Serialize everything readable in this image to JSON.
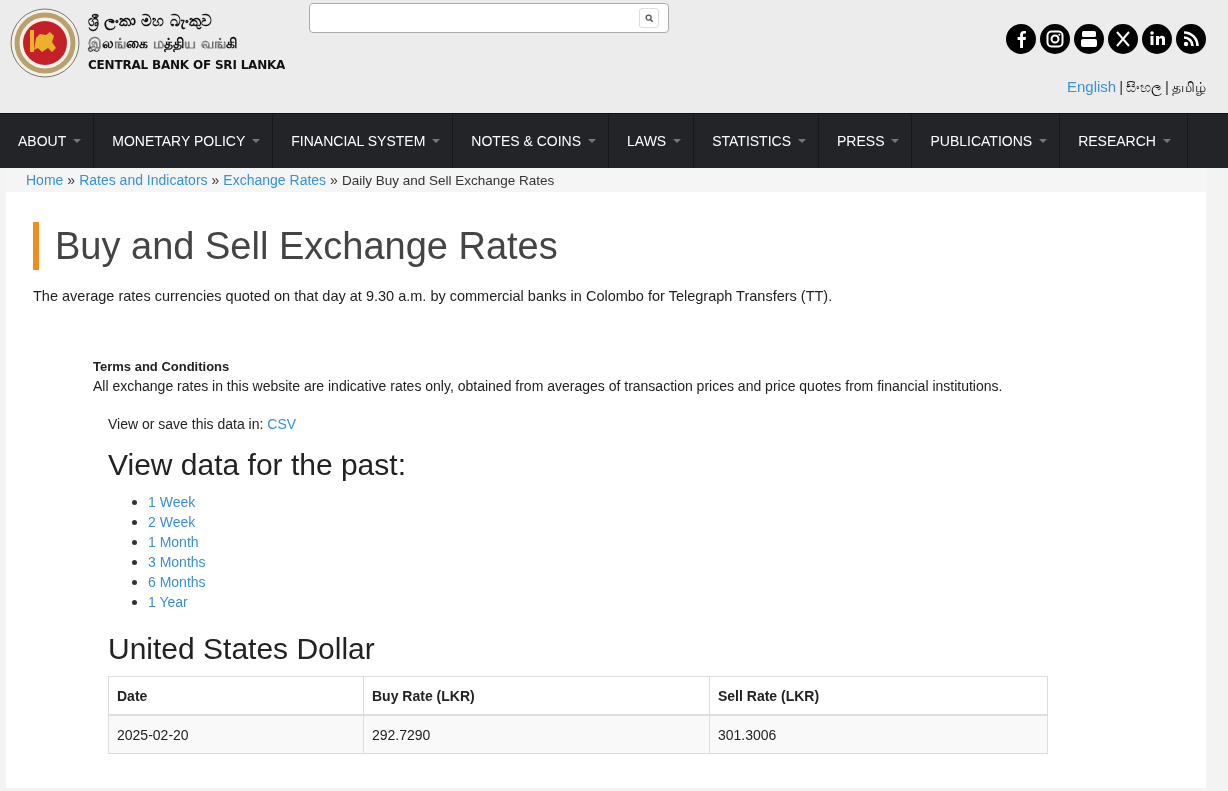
{
  "header": {
    "logo_lines": [
      "ශ්‍රී ලංකා මහ බැංකුව",
      "இலங்கை மத்திய வங்கி",
      "CENTRAL BANK OF SRI LANKA"
    ],
    "social": [
      {
        "kind": "facebook"
      },
      {
        "kind": "instagram"
      },
      {
        "kind": "youtube"
      },
      {
        "kind": "x"
      },
      {
        "kind": "linkedin"
      },
      {
        "kind": "rss"
      }
    ],
    "languages": [
      {
        "kind": "link",
        "label": "English"
      },
      {
        "kind": "sep",
        "label": "|"
      },
      {
        "kind": "text",
        "label": "සිංහල"
      },
      {
        "kind": "sep",
        "label": "|"
      },
      {
        "kind": "text",
        "label": "தமிழ்"
      }
    ]
  },
  "nav": [
    {
      "label": "ABOUT"
    },
    {
      "label": "MONETARY POLICY"
    },
    {
      "label": "FINANCIAL SYSTEM"
    },
    {
      "label": "NOTES & COINS"
    },
    {
      "label": "LAWS"
    },
    {
      "label": "STATISTICS"
    },
    {
      "label": "PRESS"
    },
    {
      "label": "PUBLICATIONS"
    },
    {
      "label": "RESEARCH"
    }
  ],
  "breadcrumb": [
    {
      "kind": "link",
      "label": "Home"
    },
    {
      "kind": "sep",
      "label": "»"
    },
    {
      "kind": "link",
      "label": "Rates and Indicators"
    },
    {
      "kind": "sep",
      "label": "»"
    },
    {
      "kind": "link",
      "label": "Exchange Rates"
    },
    {
      "kind": "sep",
      "label": "»"
    },
    {
      "kind": "current",
      "label": "Daily Buy and Sell Exchange Rates"
    }
  ],
  "page": {
    "title": "Buy and Sell Exchange Rates",
    "intro": "The average rates currencies quoted on that day at 9.30 a.m. by commercial banks in Colombo for Telegraph Transfers (TT).",
    "terms_title": "Terms and Conditions",
    "terms_text": "All exchange rates in this website are indicative rates only, obtained from averages of transaction prices and price quotes from financial institutions.",
    "export_label": "View or save this data in:",
    "export_link": "CSV",
    "past_heading": "View data for the past:",
    "periods": [
      "1 Week",
      "2 Week",
      "1 Month",
      "3 Months",
      "6 Months",
      "1 Year"
    ],
    "currency": "United States Dollar",
    "table": {
      "columns": [
        "Date",
        "Buy Rate (LKR)",
        "Sell Rate (LKR)"
      ],
      "rows": [
        [
          "2025-02-20",
          "292.7290",
          "301.3006"
        ]
      ]
    }
  }
}
